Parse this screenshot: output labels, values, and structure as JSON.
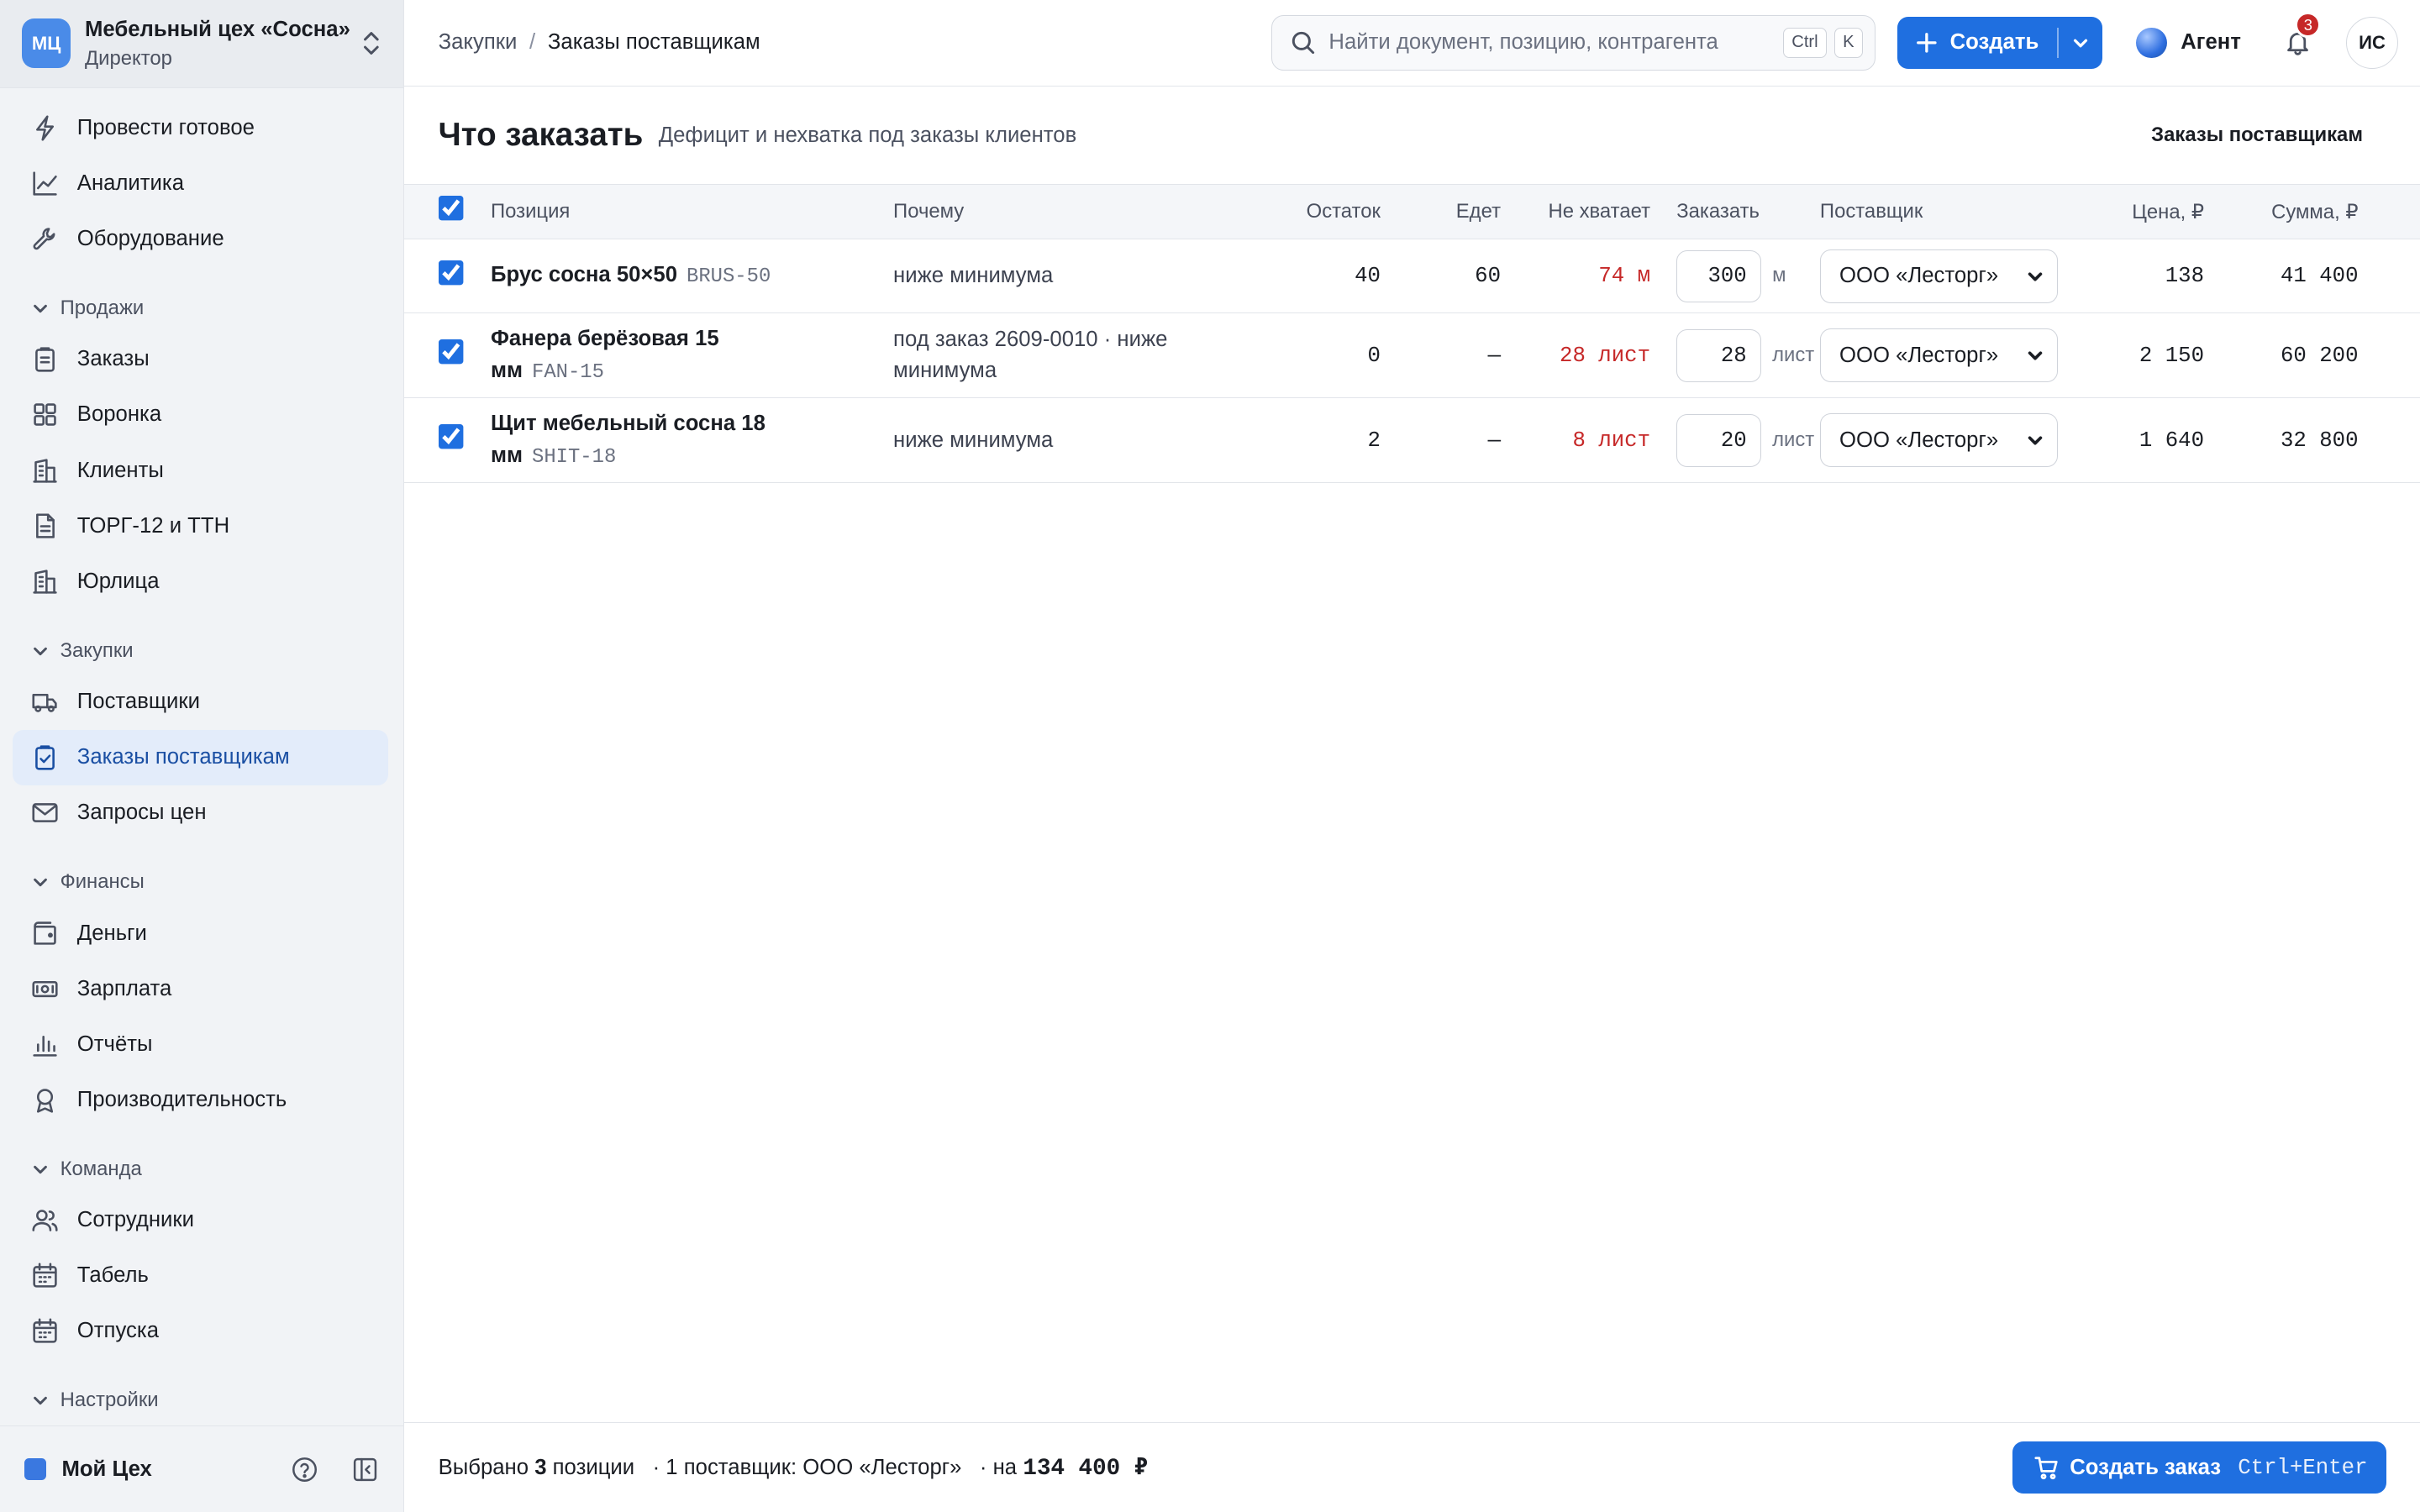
{
  "org": {
    "logo": "МЦ",
    "name": "Мебельный цех «Сосна»",
    "role": "Директор"
  },
  "sidebar": {
    "top_items": [
      {
        "label": "Провести готовое",
        "icon": "lightning-icon"
      },
      {
        "label": "Аналитика",
        "icon": "chart-line-icon"
      },
      {
        "label": "Оборудование",
        "icon": "wrench-icon"
      }
    ],
    "sections": [
      {
        "title": "Продажи",
        "items": [
          {
            "label": "Заказы",
            "icon": "clipboard-icon"
          },
          {
            "label": "Воронка",
            "icon": "grid-icon"
          },
          {
            "label": "Клиенты",
            "icon": "building-icon"
          },
          {
            "label": "ТОРГ-12 и ТТН",
            "icon": "document-icon"
          },
          {
            "label": "Юрлица",
            "icon": "building-icon"
          }
        ]
      },
      {
        "title": "Закупки",
        "items": [
          {
            "label": "Поставщики",
            "icon": "truck-icon"
          },
          {
            "label": "Заказы поставщикам",
            "icon": "clipboard-check-icon",
            "active": true
          },
          {
            "label": "Запросы цен",
            "icon": "mail-icon"
          }
        ]
      },
      {
        "title": "Финансы",
        "items": [
          {
            "label": "Деньги",
            "icon": "wallet-icon"
          },
          {
            "label": "Зарплата",
            "icon": "banknote-icon"
          },
          {
            "label": "Отчёты",
            "icon": "bar-chart-icon"
          },
          {
            "label": "Производительность",
            "icon": "award-icon"
          }
        ]
      },
      {
        "title": "Команда",
        "items": [
          {
            "label": "Сотрудники",
            "icon": "users-icon"
          },
          {
            "label": "Табель",
            "icon": "calendar-icon"
          },
          {
            "label": "Отпуска",
            "icon": "calendar-icon"
          }
        ]
      },
      {
        "title": "Настройки",
        "items": []
      }
    ],
    "workspace": "Мой Цех"
  },
  "topbar": {
    "breadcrumb_parent": "Закупки",
    "breadcrumb_sep": "/",
    "breadcrumb_current": "Заказы поставщикам",
    "search_placeholder": "Найти документ, позицию, контрагента",
    "kbd_ctrl": "Ctrl",
    "kbd_k": "K",
    "create_label": "Создать",
    "agent_label": "Агент",
    "notifications_count": "3",
    "avatar_initials": "ИС"
  },
  "page": {
    "title": "Что заказать",
    "subtitle": "Дефицит и нехватка под заказы клиентов",
    "link_label": "Заказы поставщикам"
  },
  "table": {
    "headers": {
      "position": "Позиция",
      "reason": "Почему",
      "stock": "Остаток",
      "incoming": "Едет",
      "shortage": "Не хватает",
      "order": "Заказать",
      "supplier": "Поставщик",
      "price": "Цена, ₽",
      "sum": "Сумма, ₽"
    },
    "rows": [
      {
        "name": "Брус сосна 50×50",
        "sku": "BRUS-50",
        "reason": "ниже минимума",
        "stock": "40",
        "incoming": "60",
        "shortage": "74 м",
        "qty": "300",
        "unit": "м",
        "supplier": "ООО «Лесторг»",
        "price": "138",
        "sum": "41 400",
        "checked": true
      },
      {
        "name": "Фанера берёзовая 15 мм",
        "sku": "FAN-15",
        "reason": "под заказ 2609-0010 · ниже минимума",
        "stock": "0",
        "incoming": "—",
        "shortage": "28 лист",
        "qty": "28",
        "unit": "лист",
        "supplier": "ООО «Лесторг»",
        "price": "2 150",
        "sum": "60 200",
        "checked": true
      },
      {
        "name": "Щит мебельный сосна 18 мм",
        "sku": "SHIT-18",
        "reason": "ниже минимума",
        "stock": "2",
        "incoming": "—",
        "shortage": "8 лист",
        "qty": "20",
        "unit": "лист",
        "supplier": "ООО «Лесторг»",
        "price": "1 640",
        "sum": "32 800",
        "checked": true
      }
    ]
  },
  "footer": {
    "selected_prefix": "Выбрано",
    "selected_count": "3",
    "selected_suffix": "позиции",
    "suppliers_text": "· 1 поставщик: ООО «Лесторг»",
    "total_prefix": "· на",
    "total": "134 400 ₽",
    "order_button": "Создать заказ",
    "order_hotkey": "Ctrl+Enter"
  },
  "colors": {
    "accent": "#1f6fe0",
    "deficit": "#c62828",
    "active_nav_bg": "#e3ecfa"
  }
}
